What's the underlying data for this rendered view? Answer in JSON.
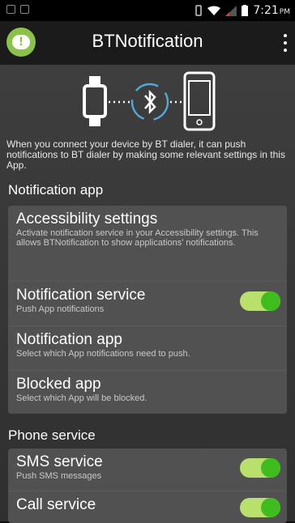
{
  "status_bar": {
    "time": "7:21",
    "ampm": "PM"
  },
  "app_bar": {
    "title": "BTNotification"
  },
  "intro": {
    "text": "When you connect your device by BT dialer, it can push notifications to BT dialer by making some relevant settings in this App."
  },
  "sections": {
    "notification": {
      "title": "Notification app",
      "rows": [
        {
          "title": "Accessibility settings",
          "desc": "Activate notification service in your Accessibility settings. This allows BTNotification to show applications' notifications."
        },
        {
          "title": "Notification service",
          "desc": "Push App notifications",
          "toggle": "on"
        },
        {
          "title": "Notification app",
          "desc": "Select which App notifications need to push."
        },
        {
          "title": "Blocked app",
          "desc": "Select which App will be blocked."
        }
      ]
    },
    "phone": {
      "title": "Phone service",
      "rows": [
        {
          "title": "SMS service",
          "desc": "Push SMS messages",
          "toggle": "on"
        },
        {
          "title": "Call service",
          "desc": "",
          "toggle": "on"
        }
      ]
    }
  },
  "colors": {
    "toggle_on": "#3fbd1f",
    "accent": "#8bc34a"
  },
  "icons": [
    "app-logo-icon",
    "overflow-menu-icon",
    "smartwatch-icon",
    "bluetooth-icon",
    "smartphone-icon"
  ]
}
